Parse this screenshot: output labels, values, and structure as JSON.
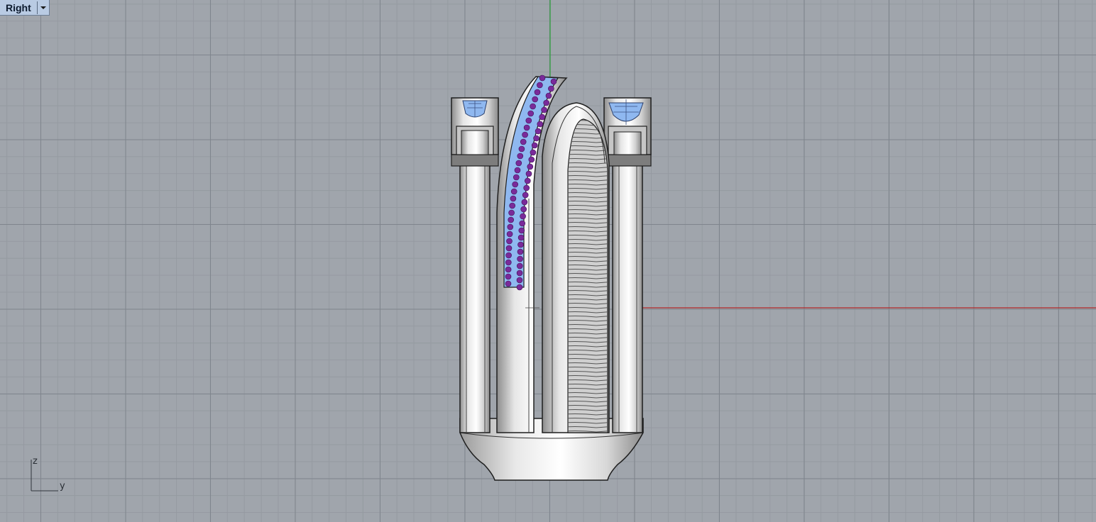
{
  "viewport": {
    "name": "Right",
    "has_dropdown": true
  },
  "axes": {
    "vertical_label": "z",
    "horizontal_label": "y",
    "x_axis_color": "#b22a2a",
    "z_axis_color": "#2aa03a"
  },
  "colors": {
    "background": "#a0a5ac",
    "grid_major": "#7f858d",
    "grid_minor": "#959aa1",
    "metal": "#d7d7d7",
    "gem_blue": "#8fb8f0",
    "gem_purple": "#7a2a9a"
  },
  "icons": {
    "dropdown": "caret-down-icon"
  }
}
